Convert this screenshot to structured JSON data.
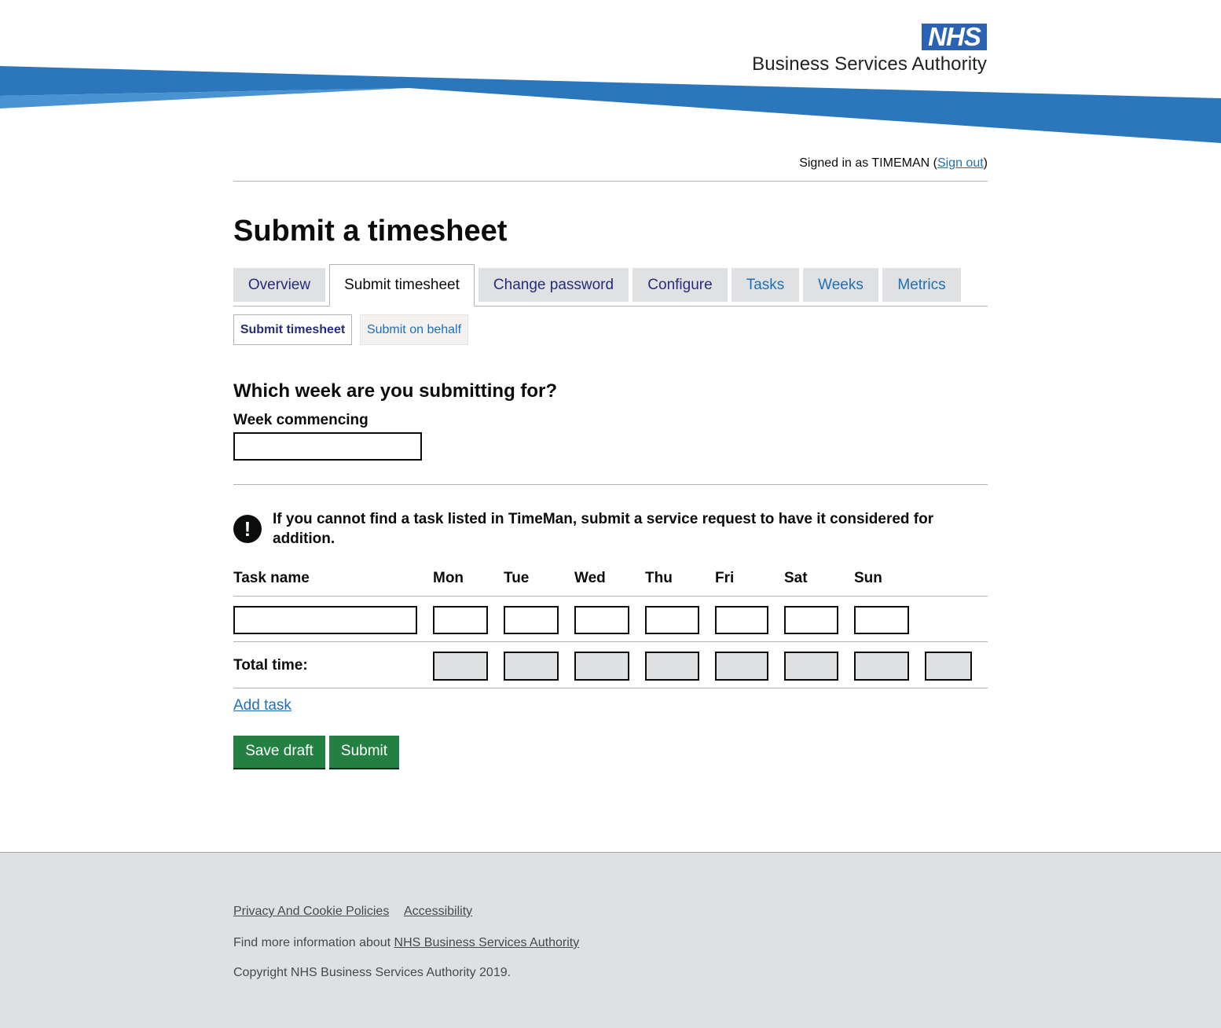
{
  "brand": {
    "logo_text": "NHS",
    "org_name": "Business Services Authority",
    "primary_blue": "#2a63b4",
    "swoosh_blue": "#2c77bc",
    "swoosh_light": "#4a93d3"
  },
  "account": {
    "signed_in_prefix": "Signed in as TIMEMAN (",
    "sign_out_label": "Sign out",
    "signed_in_suffix": ")"
  },
  "page": {
    "title": "Submit a timesheet"
  },
  "tabs": [
    {
      "label": "Overview",
      "active": false
    },
    {
      "label": "Submit timesheet",
      "active": true
    },
    {
      "label": "Change password",
      "active": false
    },
    {
      "label": "Configure",
      "active": false
    },
    {
      "label": "Tasks",
      "active": false
    },
    {
      "label": "Weeks",
      "active": false
    },
    {
      "label": "Metrics",
      "active": false
    }
  ],
  "subnav": [
    {
      "label": "Submit timesheet",
      "active": true
    },
    {
      "label": "Submit on behalf",
      "active": false
    }
  ],
  "week": {
    "question": "Which week are you submitting for?",
    "label": "Week commencing",
    "value": ""
  },
  "warning": {
    "icon": "exclamation-icon",
    "icon_glyph": "!",
    "text": "If you cannot find a task listed in TimeMan, submit a service request to have it considered for addition."
  },
  "table": {
    "headers": {
      "task": "Task name",
      "days": [
        "Mon",
        "Tue",
        "Wed",
        "Thu",
        "Fri",
        "Sat",
        "Sun"
      ]
    },
    "rows": [
      {
        "task": "",
        "hours": [
          "",
          "",
          "",
          "",
          "",
          "",
          ""
        ]
      }
    ],
    "total_label": "Total time:"
  },
  "actions": {
    "add_task": "Add task",
    "save_draft": "Save draft",
    "submit": "Submit",
    "button_color": "#247f43"
  },
  "footer": {
    "links": [
      "Privacy And Cookie Policies",
      "Accessibility"
    ],
    "info_prefix": "Find more information about ",
    "info_link": "NHS Business Services Authority",
    "copyright": "Copyright NHS Business Services Authority 2019."
  }
}
